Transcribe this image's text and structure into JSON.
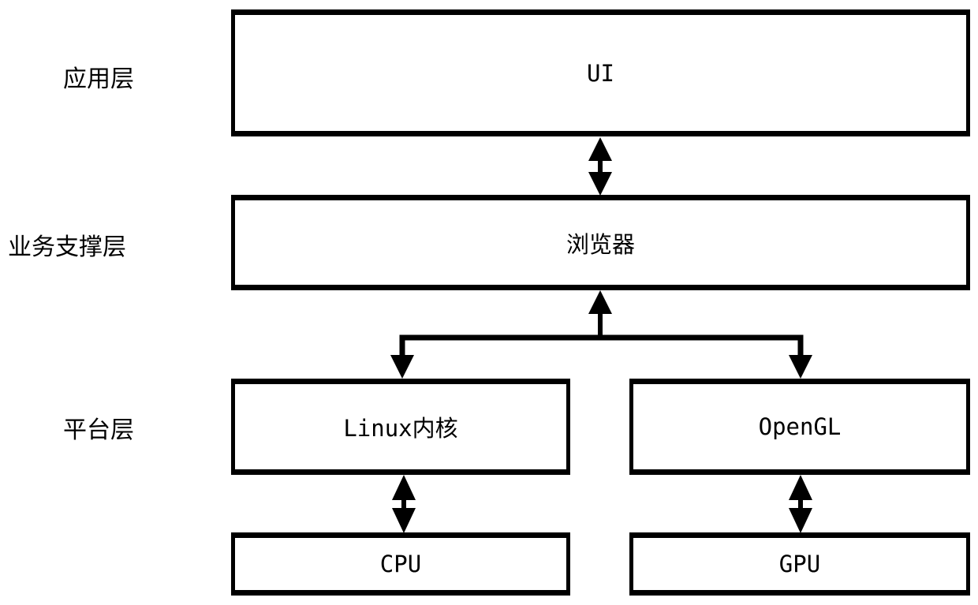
{
  "layers": {
    "application": "应用层",
    "business_support": "业务支撑层",
    "platform": "平台层"
  },
  "boxes": {
    "ui": "UI",
    "browser": "浏览器",
    "linux_kernel": "Linux内核",
    "opengl": "OpenGL",
    "cpu": "CPU",
    "gpu": "GPU"
  },
  "connections": [
    {
      "from": "ui",
      "to": "browser",
      "type": "bidirectional"
    },
    {
      "from": "browser",
      "to": [
        "linux_kernel",
        "opengl"
      ],
      "type": "branch"
    },
    {
      "from": "linux_kernel",
      "to": "cpu",
      "type": "bidirectional"
    },
    {
      "from": "opengl",
      "to": "gpu",
      "type": "bidirectional"
    }
  ]
}
